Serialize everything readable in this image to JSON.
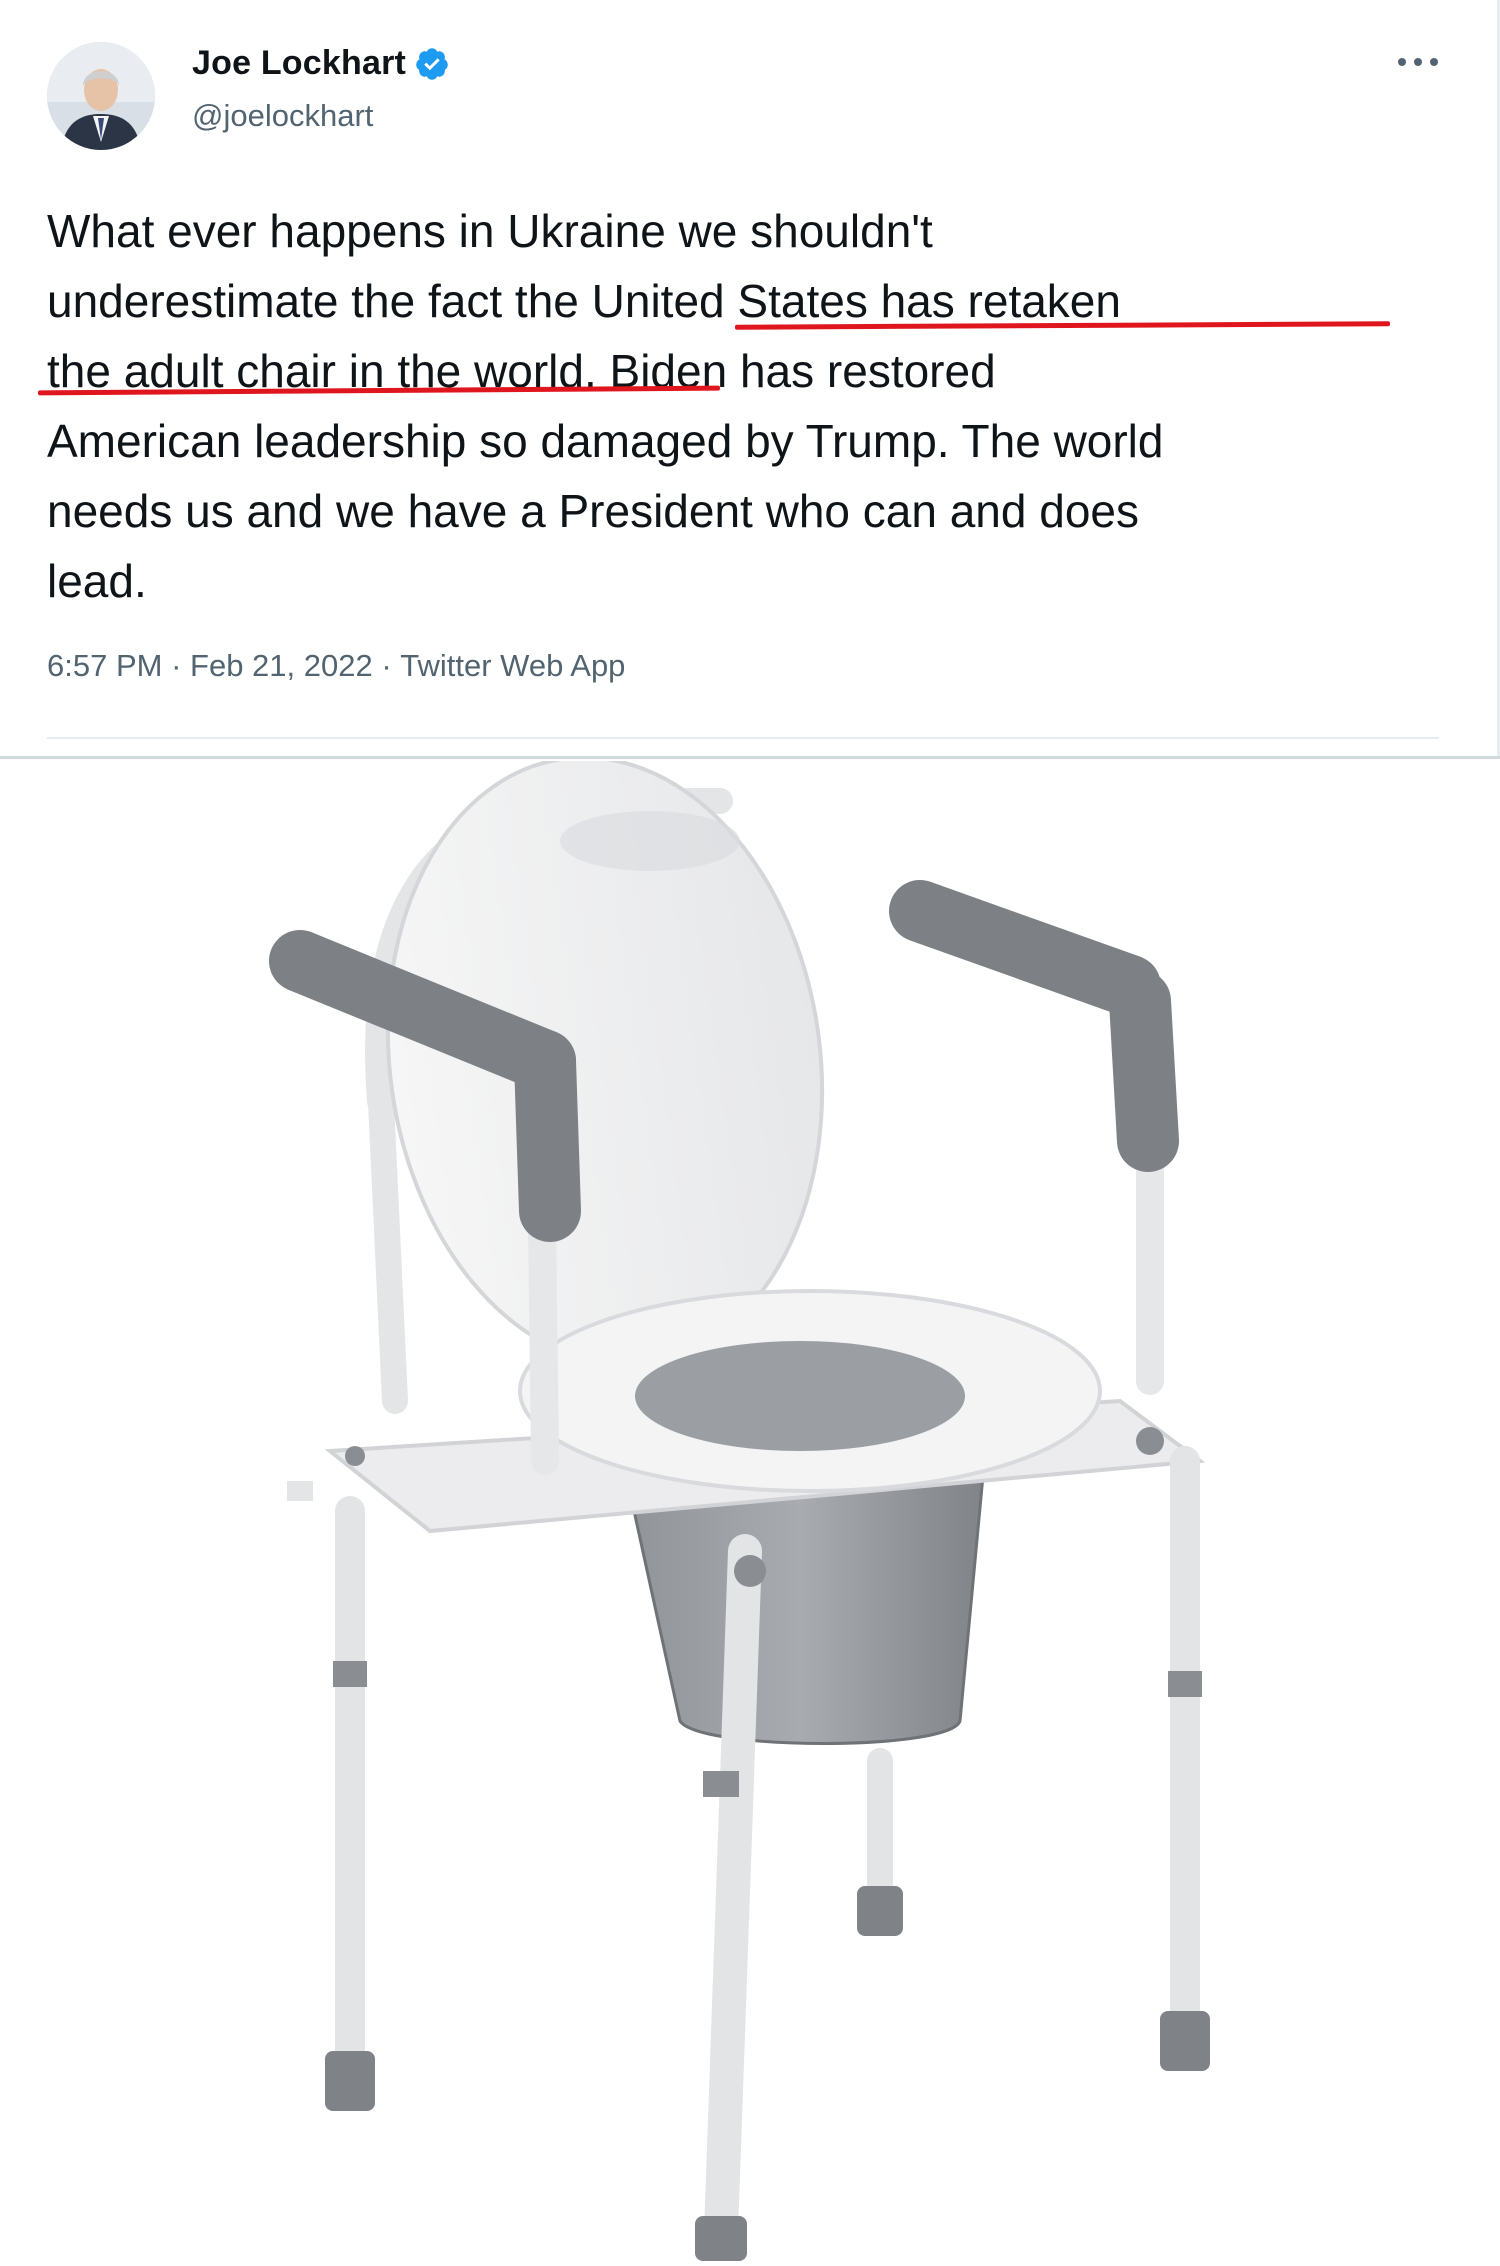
{
  "tweet": {
    "display_name": "Joe Lockhart",
    "handle": "@joelockhart",
    "body": "What ever happens in Ukraine we shouldn't\nunderestimate the fact the United States has retaken\nthe adult chair in the world. Biden has restored\nAmerican leadership so damaged by Trump. The world\nneeds us and we have a President who can and does\nlead.",
    "time": "6:57 PM",
    "separator_1": " · ",
    "date": "Feb 21, 2022",
    "separator_2": " · ",
    "source": "Twitter Web App",
    "verified_icon": "verified-badge-icon",
    "more_icon": "more-options-icon",
    "underline_color": "#e0161f",
    "accent_color": "#1d9bf0"
  },
  "photo": {
    "subject": "commode-chair"
  }
}
